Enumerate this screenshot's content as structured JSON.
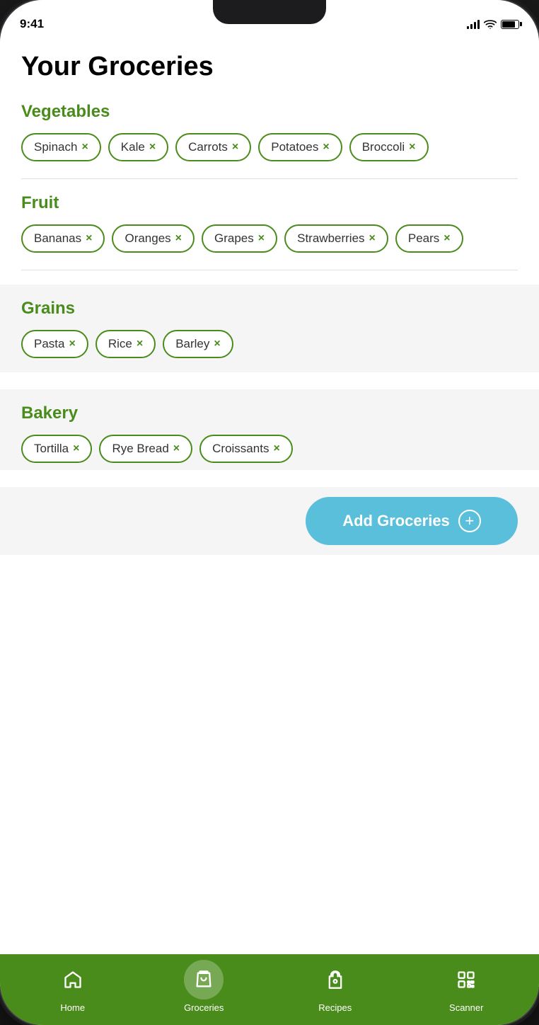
{
  "statusBar": {
    "time": "9:41"
  },
  "page": {
    "title": "Your Groceries"
  },
  "sections": [
    {
      "id": "vegetables",
      "title": "Vegetables",
      "items": [
        "Spinach",
        "Kale",
        "Carrots",
        "Potatoes",
        "Broccoli"
      ]
    },
    {
      "id": "fruit",
      "title": "Fruit",
      "items": [
        "Bananas",
        "Oranges",
        "Grapes",
        "Strawberries",
        "Pears"
      ]
    },
    {
      "id": "grains",
      "title": "Grains",
      "items": [
        "Pasta",
        "Rice",
        "Barley"
      ]
    },
    {
      "id": "bakery",
      "title": "Bakery",
      "items": [
        "Tortilla",
        "Rye Bread",
        "Croissants"
      ]
    }
  ],
  "addButton": {
    "label": "Add Groceries",
    "plusSymbol": "+"
  },
  "tabBar": {
    "tabs": [
      {
        "id": "home",
        "label": "Home"
      },
      {
        "id": "groceries",
        "label": "Groceries",
        "active": true
      },
      {
        "id": "recipes",
        "label": "Recipes"
      },
      {
        "id": "scanner",
        "label": "Scanner"
      }
    ]
  }
}
